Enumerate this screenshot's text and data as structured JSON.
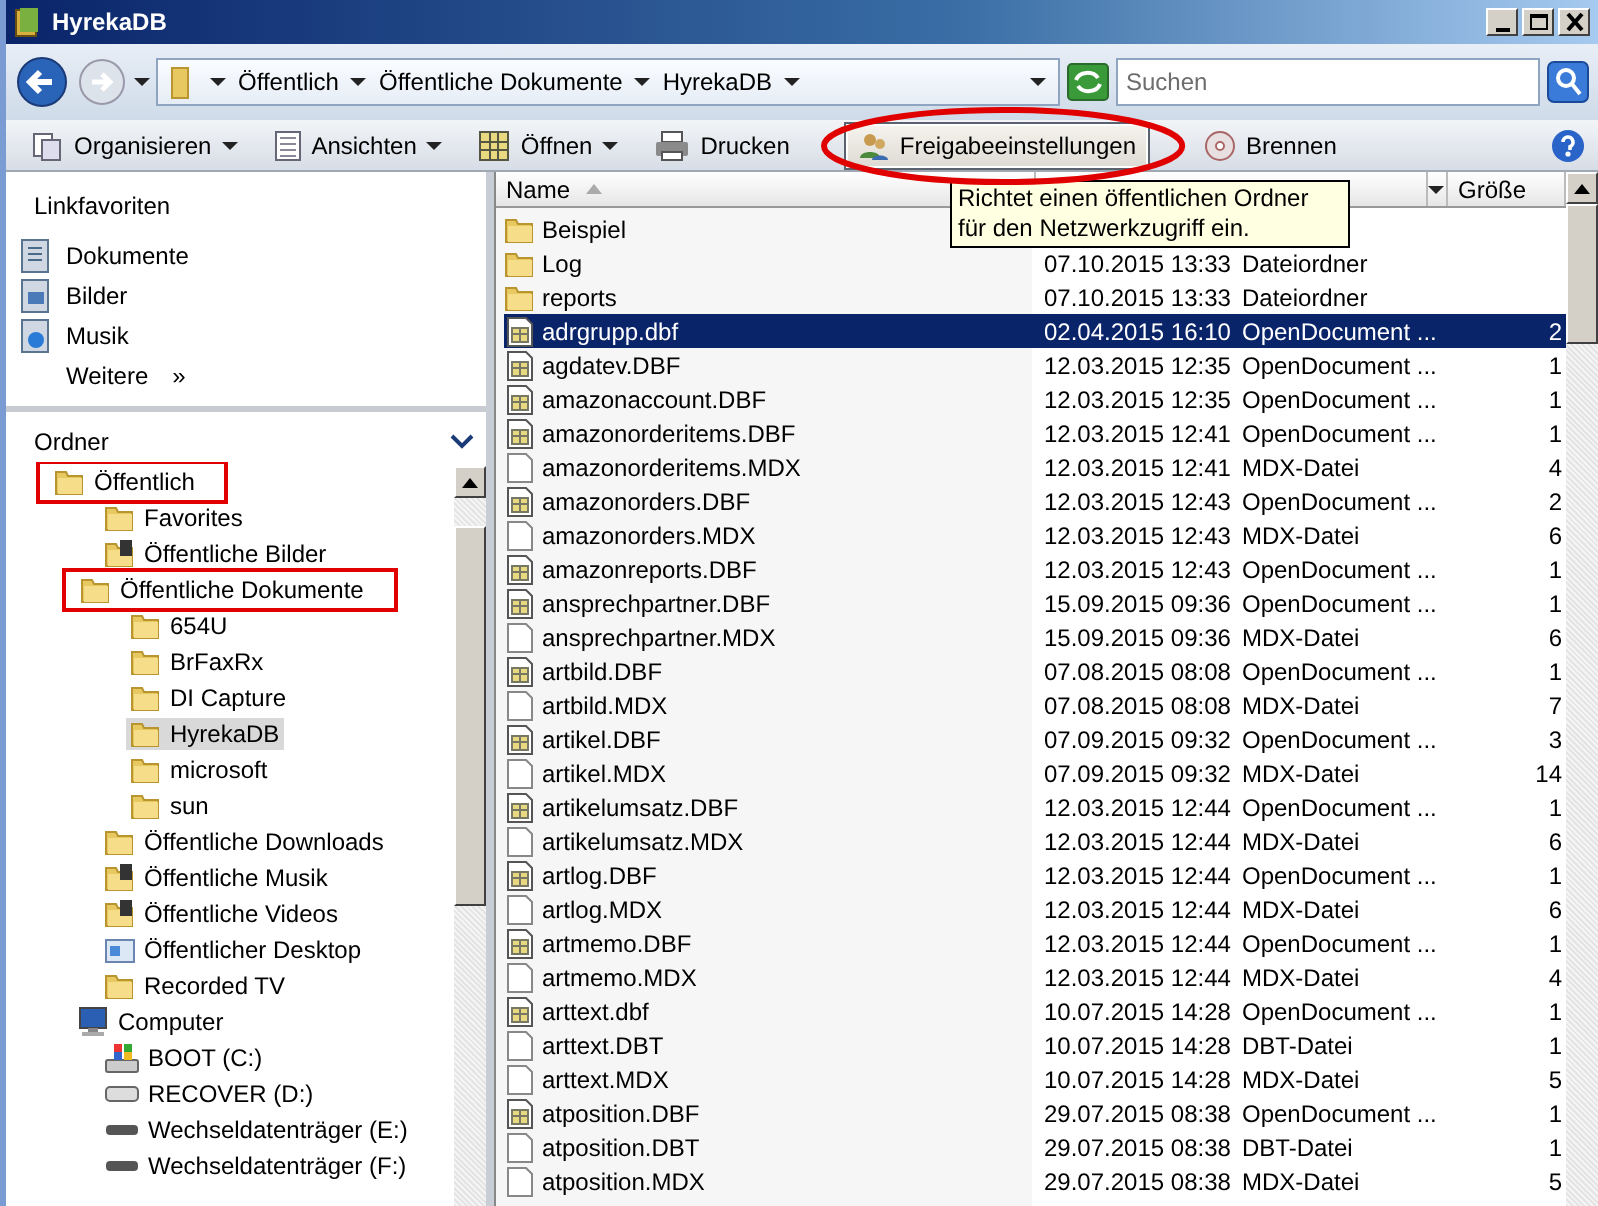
{
  "window": {
    "title": "HyrekaDB"
  },
  "address_bar": {
    "crumbs": [
      "Öffentlich",
      "Öffentliche Dokumente",
      "HyrekaDB"
    ]
  },
  "search": {
    "placeholder": "Suchen"
  },
  "toolbar": [
    {
      "label": "Organisieren",
      "kind": "organize",
      "dropdown": true,
      "hovered": false,
      "circled": false
    },
    {
      "label": "Ansichten",
      "kind": "views",
      "dropdown": true,
      "hovered": false,
      "circled": false
    },
    {
      "label": "Öffnen",
      "kind": "open",
      "dropdown": true,
      "hovered": false,
      "circled": false
    },
    {
      "label": "Drucken",
      "kind": "print",
      "dropdown": false,
      "hovered": false,
      "circled": false
    },
    {
      "label": "Freigabeeinstellungen",
      "kind": "share",
      "dropdown": false,
      "hovered": true,
      "circled": true
    },
    {
      "label": "Brennen",
      "kind": "burn",
      "dropdown": false,
      "hovered": false,
      "circled": false
    }
  ],
  "tooltip": "Richtet einen öffentlichen Ordner für den Netzwerkzugriff ein.",
  "link_favorites": {
    "title": "Linkfavoriten",
    "items": [
      {
        "label": "Dokumente",
        "kind": "docs"
      },
      {
        "label": "Bilder",
        "kind": "pics"
      },
      {
        "label": "Musik",
        "kind": "music"
      }
    ],
    "more": "Weitere",
    "more_glyph": "»"
  },
  "folders": {
    "title": "Ordner",
    "tree": [
      {
        "label": "Öffentlich",
        "kind": "folder",
        "highlighted": true,
        "selected": false,
        "children": [
          {
            "label": "Favorites",
            "kind": "folder",
            "highlighted": false,
            "selected": false
          },
          {
            "label": "Öffentliche Bilder",
            "kind": "media",
            "highlighted": false,
            "selected": false
          },
          {
            "label": "Öffentliche Dokumente",
            "kind": "folder",
            "highlighted": true,
            "selected": false,
            "children": [
              {
                "label": "654U",
                "kind": "folder",
                "highlighted": false,
                "selected": false
              },
              {
                "label": "BrFaxRx",
                "kind": "folder",
                "highlighted": false,
                "selected": false
              },
              {
                "label": "DI Capture",
                "kind": "folder",
                "highlighted": false,
                "selected": false
              },
              {
                "label": "HyrekaDB",
                "kind": "folder",
                "highlighted": false,
                "selected": true
              },
              {
                "label": "microsoft",
                "kind": "folder",
                "highlighted": false,
                "selected": false
              },
              {
                "label": "sun",
                "kind": "folder",
                "highlighted": false,
                "selected": false
              }
            ]
          },
          {
            "label": "Öffentliche Downloads",
            "kind": "folder",
            "highlighted": false,
            "selected": false
          },
          {
            "label": "Öffentliche Musik",
            "kind": "media",
            "highlighted": false,
            "selected": false
          },
          {
            "label": "Öffentliche Videos",
            "kind": "media",
            "highlighted": false,
            "selected": false
          },
          {
            "label": "Öffentlicher Desktop",
            "kind": "desktop",
            "highlighted": false,
            "selected": false
          },
          {
            "label": "Recorded TV",
            "kind": "folder",
            "highlighted": false,
            "selected": false
          }
        ]
      },
      {
        "label": "Computer",
        "kind": "computer",
        "highlighted": false,
        "selected": false,
        "children": [
          {
            "label": "BOOT (C:)",
            "kind": "windrive",
            "highlighted": false,
            "selected": false
          },
          {
            "label": "RECOVER (D:)",
            "kind": "drive",
            "highlighted": false,
            "selected": false
          },
          {
            "label": "Wechseldatenträger (E:)",
            "kind": "removable",
            "highlighted": false,
            "selected": false
          },
          {
            "label": "Wechseldatenträger (F:)",
            "kind": "removable",
            "highlighted": false,
            "selected": false
          }
        ]
      }
    ]
  },
  "file_list": {
    "columns": [
      "Name",
      "Größe"
    ],
    "rows": [
      {
        "name": "Beispiel",
        "kind": "folder",
        "selected": false
      },
      {
        "name": "Log",
        "date": "07.10.2015 13:33",
        "type": "Dateiordner",
        "kind": "folder",
        "selected": false
      },
      {
        "name": "reports",
        "date": "07.10.2015 13:33",
        "type": "Dateiordner",
        "kind": "folder",
        "selected": false
      },
      {
        "name": "adrgrupp.dbf",
        "date": "02.04.2015 16:10",
        "type": "OpenDocument ...",
        "size": "2",
        "kind": "dbf",
        "selected": true
      },
      {
        "name": "agdatev.DBF",
        "date": "12.03.2015 12:35",
        "type": "OpenDocument ...",
        "size": "1",
        "kind": "dbf",
        "selected": false
      },
      {
        "name": "amazonaccount.DBF",
        "date": "12.03.2015 12:35",
        "type": "OpenDocument ...",
        "size": "1",
        "kind": "dbf",
        "selected": false
      },
      {
        "name": "amazonorderitems.DBF",
        "date": "12.03.2015 12:41",
        "type": "OpenDocument ...",
        "size": "1",
        "kind": "dbf",
        "selected": false
      },
      {
        "name": "amazonorderitems.MDX",
        "date": "12.03.2015 12:41",
        "type": "MDX-Datei",
        "size": "4",
        "kind": "file",
        "selected": false
      },
      {
        "name": "amazonorders.DBF",
        "date": "12.03.2015 12:43",
        "type": "OpenDocument ...",
        "size": "2",
        "kind": "dbf",
        "selected": false
      },
      {
        "name": "amazonorders.MDX",
        "date": "12.03.2015 12:43",
        "type": "MDX-Datei",
        "size": "6",
        "kind": "file",
        "selected": false
      },
      {
        "name": "amazonreports.DBF",
        "date": "12.03.2015 12:43",
        "type": "OpenDocument ...",
        "size": "1",
        "kind": "dbf",
        "selected": false
      },
      {
        "name": "ansprechpartner.DBF",
        "date": "15.09.2015 09:36",
        "type": "OpenDocument ...",
        "size": "1",
        "kind": "dbf",
        "selected": false
      },
      {
        "name": "ansprechpartner.MDX",
        "date": "15.09.2015 09:36",
        "type": "MDX-Datei",
        "size": "6",
        "kind": "file",
        "selected": false
      },
      {
        "name": "artbild.DBF",
        "date": "07.08.2015 08:08",
        "type": "OpenDocument ...",
        "size": "1",
        "kind": "dbf",
        "selected": false
      },
      {
        "name": "artbild.MDX",
        "date": "07.08.2015 08:08",
        "type": "MDX-Datei",
        "size": "7",
        "kind": "file",
        "selected": false
      },
      {
        "name": "artikel.DBF",
        "date": "07.09.2015 09:32",
        "type": "OpenDocument ...",
        "size": "3",
        "kind": "dbf",
        "selected": false
      },
      {
        "name": "artikel.MDX",
        "date": "07.09.2015 09:32",
        "type": "MDX-Datei",
        "size": "14",
        "kind": "file",
        "selected": false
      },
      {
        "name": "artikelumsatz.DBF",
        "date": "12.03.2015 12:44",
        "type": "OpenDocument ...",
        "size": "1",
        "kind": "dbf",
        "selected": false
      },
      {
        "name": "artikelumsatz.MDX",
        "date": "12.03.2015 12:44",
        "type": "MDX-Datei",
        "size": "6",
        "kind": "file",
        "selected": false
      },
      {
        "name": "artlog.DBF",
        "date": "12.03.2015 12:44",
        "type": "OpenDocument ...",
        "size": "1",
        "kind": "dbf",
        "selected": false
      },
      {
        "name": "artlog.MDX",
        "date": "12.03.2015 12:44",
        "type": "MDX-Datei",
        "size": "6",
        "kind": "file",
        "selected": false
      },
      {
        "name": "artmemo.DBF",
        "date": "12.03.2015 12:44",
        "type": "OpenDocument ...",
        "size": "1",
        "kind": "dbf",
        "selected": false
      },
      {
        "name": "artmemo.MDX",
        "date": "12.03.2015 12:44",
        "type": "MDX-Datei",
        "size": "4",
        "kind": "file",
        "selected": false
      },
      {
        "name": "arttext.dbf",
        "date": "10.07.2015 14:28",
        "type": "OpenDocument ...",
        "size": "1",
        "kind": "dbf",
        "selected": false
      },
      {
        "name": "arttext.DBT",
        "date": "10.07.2015 14:28",
        "type": "DBT-Datei",
        "size": "1",
        "kind": "file",
        "selected": false
      },
      {
        "name": "arttext.MDX",
        "date": "10.07.2015 14:28",
        "type": "MDX-Datei",
        "size": "5",
        "kind": "file",
        "selected": false
      },
      {
        "name": "atposition.DBF",
        "date": "29.07.2015 08:38",
        "type": "OpenDocument ...",
        "size": "1",
        "kind": "dbf",
        "selected": false
      },
      {
        "name": "atposition.DBT",
        "date": "29.07.2015 08:38",
        "type": "DBT-Datei",
        "size": "1",
        "kind": "file",
        "selected": false
      },
      {
        "name": "atposition.MDX",
        "date": "29.07.2015 08:38",
        "type": "MDX-Datei",
        "size": "5",
        "kind": "file",
        "selected": false
      }
    ]
  }
}
